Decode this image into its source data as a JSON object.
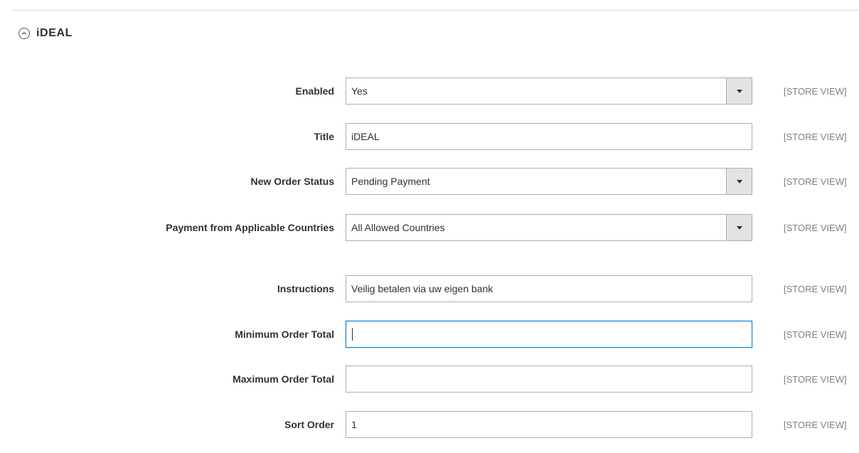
{
  "section": {
    "title": "iDEAL"
  },
  "fields": {
    "enabled": {
      "label": "Enabled",
      "value": "Yes",
      "scope": "[STORE VIEW]"
    },
    "title": {
      "label": "Title",
      "value": "iDEAL",
      "scope": "[STORE VIEW]"
    },
    "new_order_status": {
      "label": "New Order Status",
      "value": "Pending Payment",
      "scope": "[STORE VIEW]"
    },
    "payment_countries": {
      "label": "Payment from Applicable Countries",
      "value": "All Allowed Countries",
      "scope": "[STORE VIEW]"
    },
    "instructions": {
      "label": "Instructions",
      "value": "Veilig betalen via uw eigen bank",
      "scope": "[STORE VIEW]"
    },
    "min_order_total": {
      "label": "Minimum Order Total",
      "value": "",
      "scope": "[STORE VIEW]"
    },
    "max_order_total": {
      "label": "Maximum Order Total",
      "value": "",
      "scope": "[STORE VIEW]"
    },
    "sort_order": {
      "label": "Sort Order",
      "value": "1",
      "scope": "[STORE VIEW]"
    }
  },
  "icons": {
    "collapse": "collapse-circle-chevron-up-icon",
    "select_arrow": "triangle-down-icon"
  },
  "colors": {
    "focus_border": "#007bdb",
    "select_button_bg": "#e3e3e3",
    "scope_text": "#808080"
  }
}
